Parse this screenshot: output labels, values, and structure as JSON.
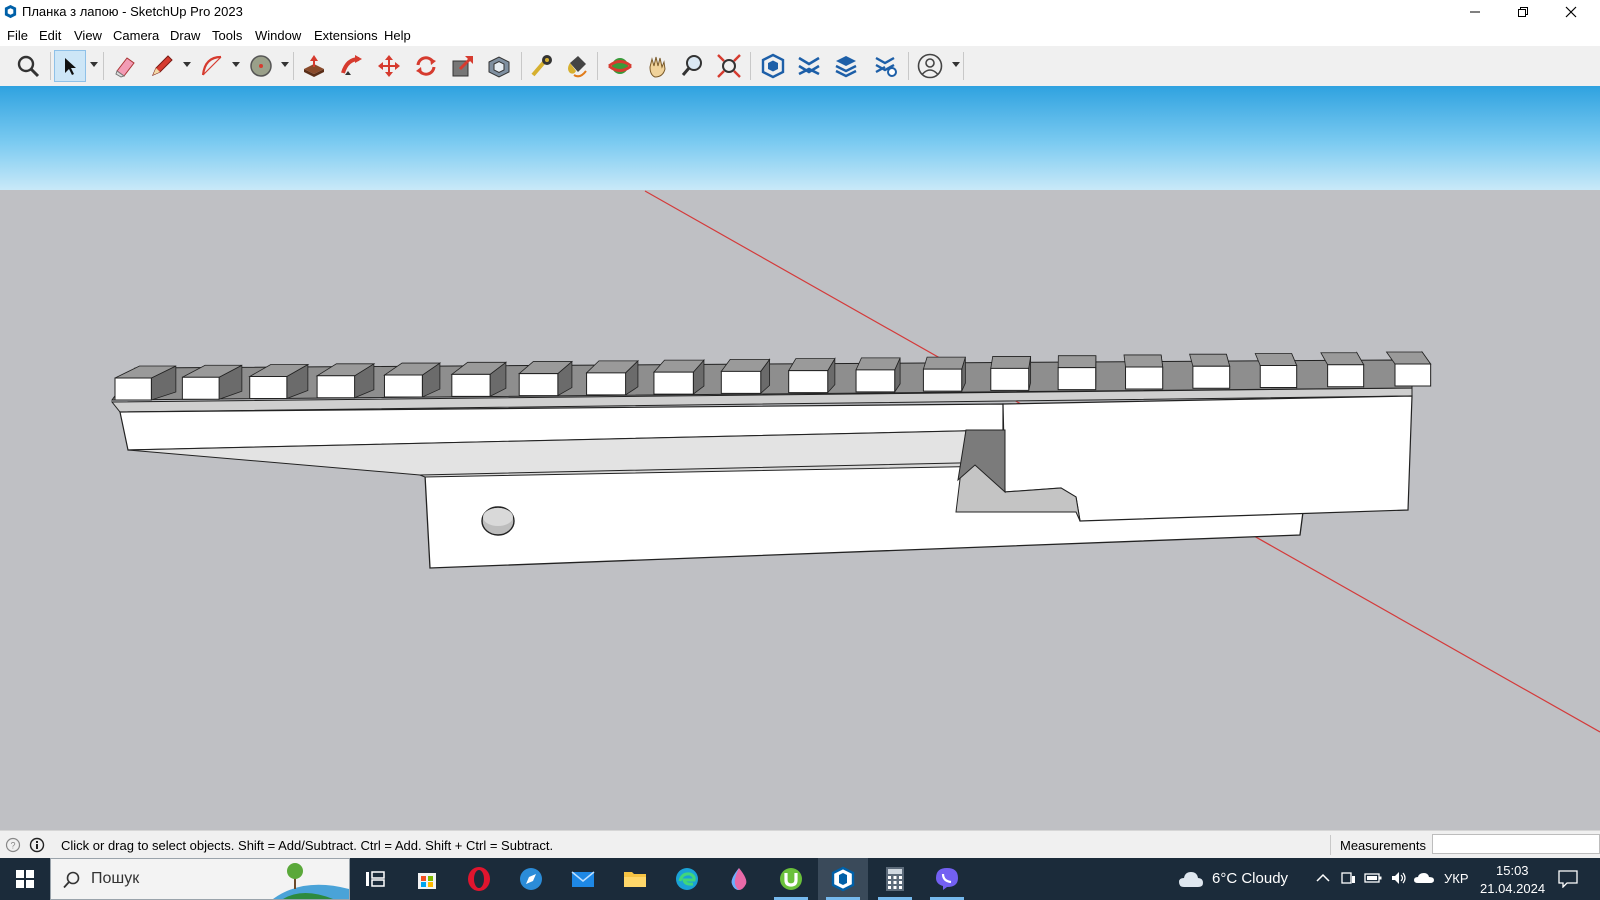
{
  "window": {
    "title": "Планка з лапою - SketchUp Pro 2023"
  },
  "menu": [
    "File",
    "Edit",
    "View",
    "Camera",
    "Draw",
    "Tools",
    "Window",
    "Extensions",
    "Help"
  ],
  "toolbar": {
    "tools": [
      {
        "name": "zoom-window-icon"
      },
      {
        "name": "select-icon",
        "active": true,
        "dropdown": true
      },
      {
        "name": "eraser-icon"
      },
      {
        "name": "pencil-line-icon",
        "dropdown": true
      },
      {
        "name": "arc-icon",
        "dropdown": true
      },
      {
        "name": "circle-icon",
        "dropdown": true
      },
      {
        "name": "push-pull-icon"
      },
      {
        "name": "follow-me-icon"
      },
      {
        "name": "move-icon"
      },
      {
        "name": "rotate-icon"
      },
      {
        "name": "scale-icon"
      },
      {
        "name": "offset-icon"
      },
      {
        "name": "tape-measure-icon"
      },
      {
        "name": "paint-bucket-icon"
      },
      {
        "name": "orbit-icon"
      },
      {
        "name": "pan-icon"
      },
      {
        "name": "zoom-icon"
      },
      {
        "name": "zoom-extents-icon"
      },
      {
        "name": "warehouse-icon"
      },
      {
        "name": "extension-warehouse-icon"
      },
      {
        "name": "layout-icon"
      },
      {
        "name": "extension-manager-icon"
      },
      {
        "name": "account-icon",
        "dropdown": true
      }
    ]
  },
  "statusbar": {
    "hint": "Click or drag to select objects. Shift = Add/Subtract. Ctrl = Add. Shift + Ctrl = Subtract.",
    "measurements_label": "Measurements"
  },
  "taskbar": {
    "search_placeholder": "Пошук",
    "apps": [
      "task-view-icon",
      "store-icon",
      "opera-icon",
      "browser-icon",
      "mail-icon",
      "file-explorer-icon",
      "edge-icon",
      "paint-drop-icon",
      "utorrent-icon",
      "sketchup-icon",
      "calculator-icon",
      "viber-icon"
    ],
    "weather": "6°C  Cloudy",
    "language": "УКР",
    "time": "15:03",
    "date": "21.04.2024"
  },
  "colors": {
    "accent": "#0078d7",
    "axis_red": "#d43a3a",
    "ground": "#bfc0c4",
    "sky_top": "#2fa2e0",
    "taskbar": "#1b2b3a"
  }
}
